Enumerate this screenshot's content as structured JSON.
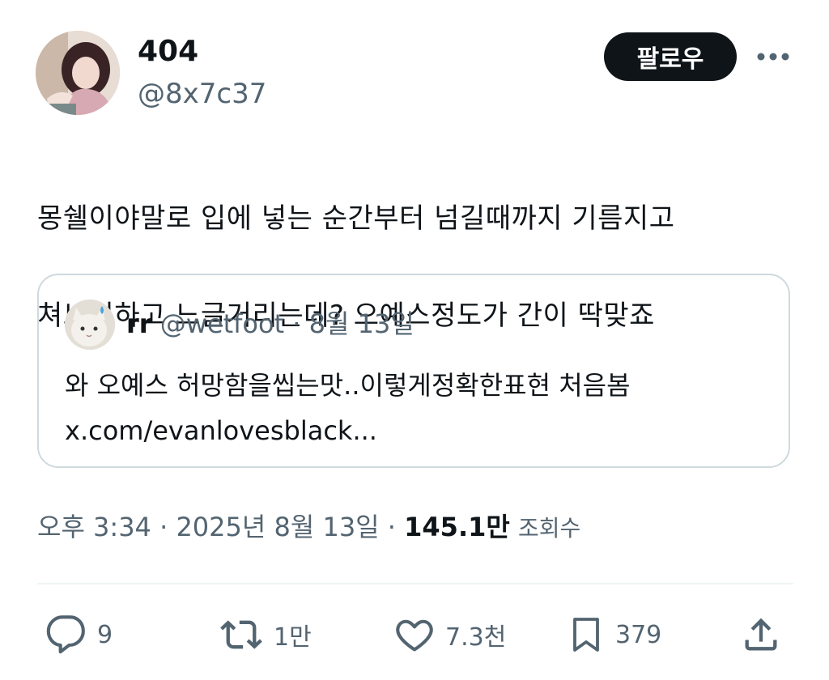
{
  "author": {
    "display_name": "404",
    "handle": "@8x7c37"
  },
  "header": {
    "follow_label": "팔로우"
  },
  "tweet": {
    "text_line1": "몽쉘이야말로 입에 넣는 순간부터 넘길때까지 기름지고",
    "text_line2": "쳐느끼하고 느글거리는데? 오예스정도가 간이 딱맞죠"
  },
  "quote": {
    "name": "rr",
    "handle": "@wetfoot",
    "separator": " · ",
    "date": "8월 13일",
    "body": "와 오예스 허망함을씹는맛..이렇게정확한표현 처음봄",
    "link": "x.com/evanlovesblack..."
  },
  "meta": {
    "time": "오후 3:34",
    "sep": " · ",
    "date": "2025년 8월 13일",
    "views_count": "145.1만",
    "views_label": "조회수"
  },
  "actions": {
    "replies": "9",
    "reposts": "1만",
    "likes": "7.3천",
    "bookmarks": "379"
  },
  "colors": {
    "text": "#0f1419",
    "secondary": "#536471",
    "border": "#cfd9de",
    "follow_bg": "#0f1419"
  }
}
